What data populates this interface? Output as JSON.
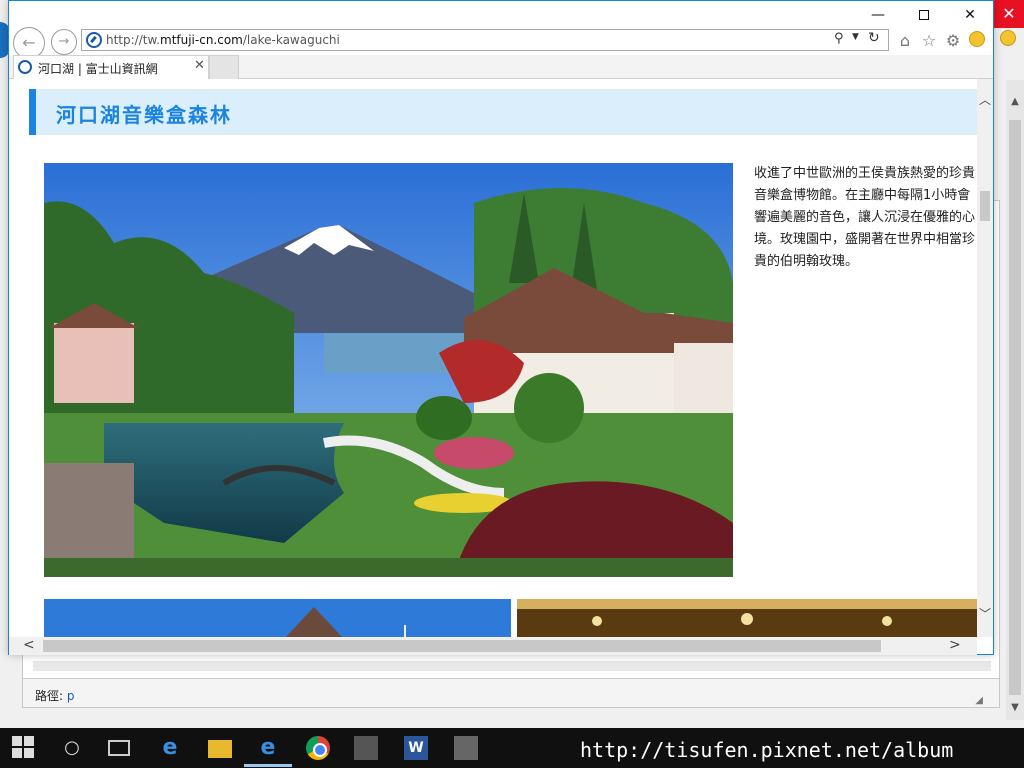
{
  "browser": {
    "url_prefix": "http://tw.",
    "url_domain": "mtfuji-cn.com",
    "url_path": "/lake-kawaguchi",
    "tab_title": "河口湖 | 富士山資訊網",
    "icons": {
      "back": "back-arrow-icon",
      "forward": "forward-arrow-icon",
      "search": "search-icon",
      "refresh": "refresh-icon",
      "home": "home-icon",
      "favorites": "star-icon",
      "settings": "gear-icon",
      "feedback": "smiley-icon"
    }
  },
  "page": {
    "section_title": "河口湖音樂盒森林",
    "description": "收進了中世歐洲的王侯貴族熱愛的珍貴音樂盒博物館。在主廳中每隔1小時會響遍美麗的音色，讓人沉浸在優雅的心境。玫瑰園中，盛開著在世界中相當珍貴的伯明翰玫瑰。",
    "accent_color": "#1a84e0",
    "header_bg": "#dbeefb"
  },
  "background_editor": {
    "path_label": "路徑:",
    "path_value": "p"
  },
  "watermark": "http://tisufen.pixnet.net/album"
}
